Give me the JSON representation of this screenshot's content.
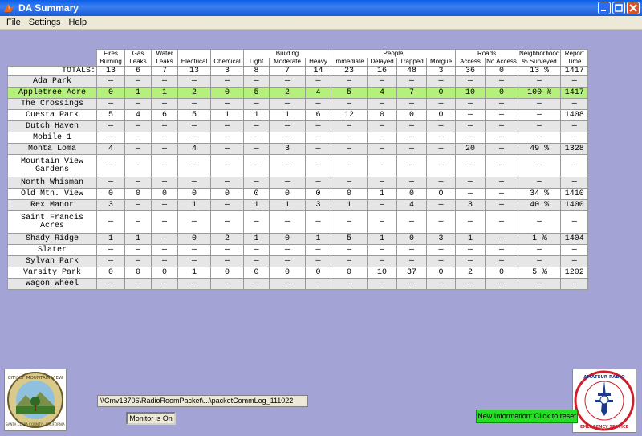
{
  "window": {
    "title": "DA Summary"
  },
  "menu": [
    "File",
    "Settings",
    "Help"
  ],
  "headers": {
    "fires_burning": [
      "Fires",
      "Burning"
    ],
    "gas_leaks": [
      "Gas",
      "Leaks"
    ],
    "water_leaks": [
      "Water",
      "Leaks"
    ],
    "building_group": "Building",
    "electrical": "Electrical",
    "chemical": "Chemical",
    "light": "Light",
    "moderate": "Moderate",
    "heavy": "Heavy",
    "people_group": "People",
    "immediate": "Immediate",
    "delayed": "Delayed",
    "trapped": "Trapped",
    "morgue": "Morgue",
    "roads_group": "Roads",
    "access": "Access",
    "no_access": "No Access",
    "neighborhood": [
      "Neighborhood",
      "% Surveyed"
    ],
    "report_time": [
      "Report",
      "Time"
    ]
  },
  "totals": {
    "label": "TOTALS:",
    "values": [
      "13",
      "6",
      "7",
      "13",
      "3",
      "8",
      "7",
      "14",
      "23",
      "16",
      "48",
      "3",
      "36",
      "0",
      "13 %",
      "1417"
    ]
  },
  "rows": [
    {
      "name": [
        "Ada Park"
      ],
      "values": [
        "—",
        "—",
        "—",
        "—",
        "—",
        "—",
        "—",
        "—",
        "—",
        "—",
        "—",
        "—",
        "—",
        "—",
        "—",
        "—"
      ]
    },
    {
      "name": [
        "Appletree Acre"
      ],
      "values": [
        "0",
        "1",
        "1",
        "2",
        "0",
        "5",
        "2",
        "4",
        "5",
        "4",
        "7",
        "0",
        "10",
        "0",
        "100 %",
        "1417"
      ]
    },
    {
      "name": [
        "The Crossings"
      ],
      "values": [
        "—",
        "—",
        "—",
        "—",
        "—",
        "—",
        "—",
        "—",
        "—",
        "—",
        "—",
        "—",
        "—",
        "—",
        "—",
        "—"
      ]
    },
    {
      "name": [
        "Cuesta Park"
      ],
      "values": [
        "5",
        "4",
        "6",
        "5",
        "1",
        "1",
        "1",
        "6",
        "12",
        "0",
        "0",
        "0",
        "—",
        "—",
        "—",
        "1408"
      ]
    },
    {
      "name": [
        "Dutch Haven"
      ],
      "values": [
        "—",
        "—",
        "—",
        "—",
        "—",
        "—",
        "—",
        "—",
        "—",
        "—",
        "—",
        "—",
        "—",
        "—",
        "—",
        "—"
      ]
    },
    {
      "name": [
        "Mobile 1"
      ],
      "values": [
        "—",
        "—",
        "—",
        "—",
        "—",
        "—",
        "—",
        "—",
        "—",
        "—",
        "—",
        "—",
        "—",
        "—",
        "—",
        "—"
      ]
    },
    {
      "name": [
        "Monta Loma"
      ],
      "values": [
        "4",
        "—",
        "—",
        "4",
        "—",
        "—",
        "3",
        "—",
        "—",
        "—",
        "—",
        "—",
        "20",
        "—",
        "49 %",
        "1328"
      ]
    },
    {
      "name": [
        "Mountain View",
        "Gardens"
      ],
      "values": [
        "—",
        "—",
        "—",
        "—",
        "—",
        "—",
        "—",
        "—",
        "—",
        "—",
        "—",
        "—",
        "—",
        "—",
        "—",
        "—"
      ]
    },
    {
      "name": [
        "North Whisman"
      ],
      "values": [
        "—",
        "—",
        "—",
        "—",
        "—",
        "—",
        "—",
        "—",
        "—",
        "—",
        "—",
        "—",
        "—",
        "—",
        "—",
        "—"
      ]
    },
    {
      "name": [
        "Old Mtn. View"
      ],
      "values": [
        "0",
        "0",
        "0",
        "0",
        "0",
        "0",
        "0",
        "0",
        "0",
        "1",
        "0",
        "0",
        "—",
        "—",
        "34 %",
        "1410"
      ]
    },
    {
      "name": [
        "Rex Manor"
      ],
      "values": [
        "3",
        "—",
        "—",
        "1",
        "—",
        "1",
        "1",
        "3",
        "1",
        "—",
        "4",
        "—",
        "3",
        "—",
        "40 %",
        "1400"
      ]
    },
    {
      "name": [
        "Saint Francis",
        "Acres"
      ],
      "values": [
        "—",
        "—",
        "—",
        "—",
        "—",
        "—",
        "—",
        "—",
        "—",
        "—",
        "—",
        "—",
        "—",
        "—",
        "—",
        "—"
      ]
    },
    {
      "name": [
        "Shady Ridge"
      ],
      "values": [
        "1",
        "1",
        "—",
        "0",
        "2",
        "1",
        "0",
        "1",
        "5",
        "1",
        "0",
        "3",
        "1",
        "—",
        "1 %",
        "1404"
      ]
    },
    {
      "name": [
        "Slater"
      ],
      "values": [
        "—",
        "—",
        "—",
        "—",
        "—",
        "—",
        "—",
        "—",
        "—",
        "—",
        "—",
        "—",
        "—",
        "—",
        "—",
        "—"
      ]
    },
    {
      "name": [
        "Sylvan Park"
      ],
      "values": [
        "—",
        "—",
        "—",
        "—",
        "—",
        "—",
        "—",
        "—",
        "—",
        "—",
        "—",
        "—",
        "—",
        "—",
        "—",
        "—"
      ]
    },
    {
      "name": [
        "Varsity Park"
      ],
      "values": [
        "0",
        "0",
        "0",
        "1",
        "0",
        "0",
        "0",
        "0",
        "0",
        "10",
        "37",
        "0",
        "2",
        "0",
        "5 %",
        "1202"
      ]
    },
    {
      "name": [
        "Wagon Wheel"
      ],
      "values": [
        "—",
        "—",
        "—",
        "—",
        "—",
        "—",
        "—",
        "—",
        "—",
        "—",
        "—",
        "—",
        "—",
        "—",
        "—",
        "—"
      ]
    }
  ],
  "highlight_row_color": "#b3f07c",
  "status": {
    "log_path": "\\\\Cmv13706\\RadioRoomPacket\\...\\packetCommLog_111022",
    "monitor": "Monitor is On",
    "new_info": "New Information: Click to reset"
  },
  "logos": {
    "left": {
      "text": [
        "CITY OF MOUNTAIN VIEW",
        "SANTA CLARA COUNTY · CALIFORNIA"
      ]
    },
    "right": {
      "text": [
        "AMATEUR RADIO",
        "EMERGENCY SERVICE"
      ]
    }
  }
}
